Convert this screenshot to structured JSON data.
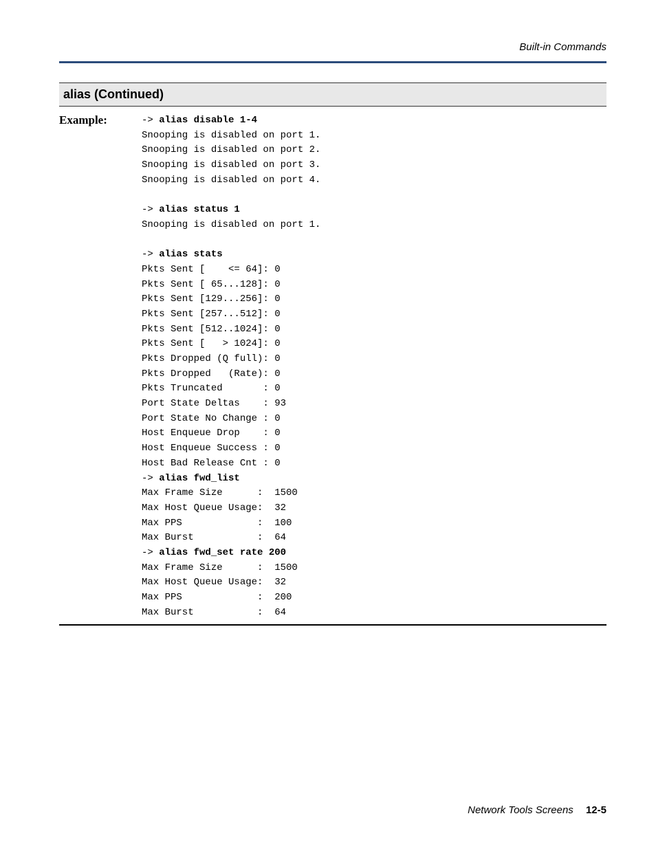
{
  "header": {
    "title": "Built-in Commands"
  },
  "section": {
    "title": "alias (Continued)"
  },
  "example": {
    "label": "Example:",
    "block1_prefix": "-> ",
    "block1_cmd": "alias disable 1-4",
    "block1_lines": [
      "Snooping is disabled on port 1.",
      "Snooping is disabled on port 2.",
      "Snooping is disabled on port 3.",
      "Snooping is disabled on port 4."
    ],
    "block2_prefix": "-> ",
    "block2_cmd": "alias status 1",
    "block2_lines": [
      "Snooping is disabled on port 1."
    ],
    "block3_prefix": "-> ",
    "block3_cmd": "alias stats",
    "block3_lines": [
      "Pkts Sent [    <= 64]: 0",
      "Pkts Sent [ 65...128]: 0",
      "Pkts Sent [129...256]: 0",
      "Pkts Sent [257...512]: 0",
      "Pkts Sent [512..1024]: 0",
      "Pkts Sent [   > 1024]: 0",
      "Pkts Dropped (Q full): 0",
      "Pkts Dropped   (Rate): 0",
      "Pkts Truncated       : 0",
      "Port State Deltas    : 93",
      "Port State No Change : 0",
      "Host Enqueue Drop    : 0",
      "Host Enqueue Success : 0",
      "Host Bad Release Cnt : 0"
    ],
    "block4_prefix": "-> ",
    "block4_cmd": "alias fwd_list",
    "block4_lines": [
      "Max Frame Size      :  1500",
      "Max Host Queue Usage:  32",
      "Max PPS             :  100",
      "Max Burst           :  64"
    ],
    "block5_prefix": "-> ",
    "block5_cmd": "alias fwd_set rate 200",
    "block5_lines": [
      "Max Frame Size      :  1500",
      "Max Host Queue Usage:  32",
      "Max PPS             :  200",
      "Max Burst           :  64"
    ]
  },
  "footer": {
    "text": "Network Tools Screens",
    "page": "12-5"
  }
}
